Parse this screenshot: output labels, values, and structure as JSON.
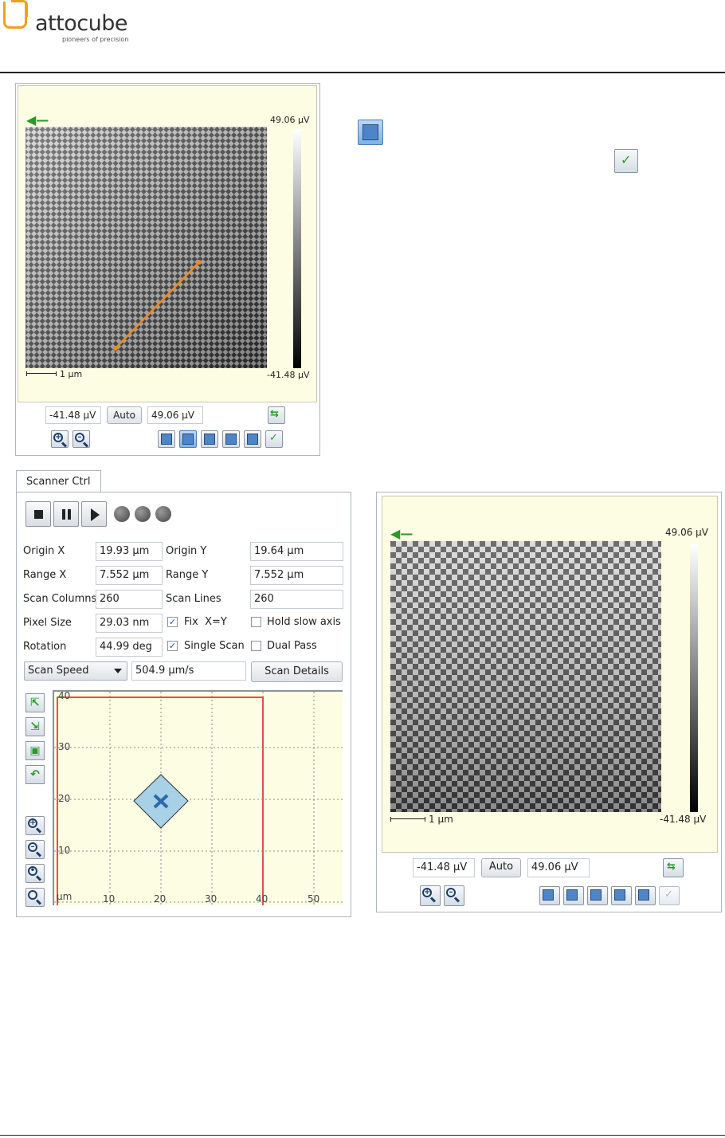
{
  "brand": {
    "name": "attocube",
    "tagline": "pioneers of precision",
    "color": "#f0a020"
  },
  "image_top": {
    "colorbar_max": "49.06 µV",
    "colorbar_min": "-41.48 µV",
    "scalebar_label": "1 µm",
    "min_value": "-41.48 µV",
    "max_value": "49.06 µV",
    "auto_label": "Auto"
  },
  "legend_icons": {
    "line_profile": "line-profile-icon",
    "checkbox": "check-icon"
  },
  "scanner": {
    "tab_label": "Scanner Ctrl",
    "origin_x_label": "Origin X",
    "origin_x": "19.93 µm",
    "origin_y_label": "Origin Y",
    "origin_y": "19.64 µm",
    "range_x_label": "Range X",
    "range_x": "7.552 µm",
    "range_y_label": "Range Y",
    "range_y": "7.552 µm",
    "scan_columns_label": "Scan Columns",
    "scan_columns": "260",
    "scan_lines_label": "Scan Lines",
    "scan_lines": "260",
    "pixel_size_label": "Pixel Size",
    "pixel_size": "29.03 nm",
    "fix_xy_label": "Fix  X=Y",
    "fix_xy_checked": true,
    "hold_slow_label": "Hold slow axis",
    "hold_slow_checked": false,
    "rotation_label": "Rotation",
    "rotation": "44.99 deg",
    "single_scan_label": "Single Scan",
    "single_scan_checked": true,
    "dual_pass_label": "Dual Pass",
    "dual_pass_checked": false,
    "speed_mode": "Scan Speed",
    "speed_value": "504.9 µm/s",
    "details_label": "Scan Details",
    "map": {
      "unit": "µm",
      "x_ticks": [
        "10",
        "20",
        "30",
        "40",
        "50"
      ],
      "y_ticks": [
        "40",
        "30",
        "20",
        "10"
      ],
      "scan_marker": "x-icon"
    }
  },
  "image_bottom": {
    "colorbar_max": "49.06 µV",
    "colorbar_min": "-41.48 µV",
    "scalebar_label": "1 µm",
    "min_value": "-41.48 µV",
    "max_value": "49.06 µV",
    "auto_label": "Auto"
  }
}
